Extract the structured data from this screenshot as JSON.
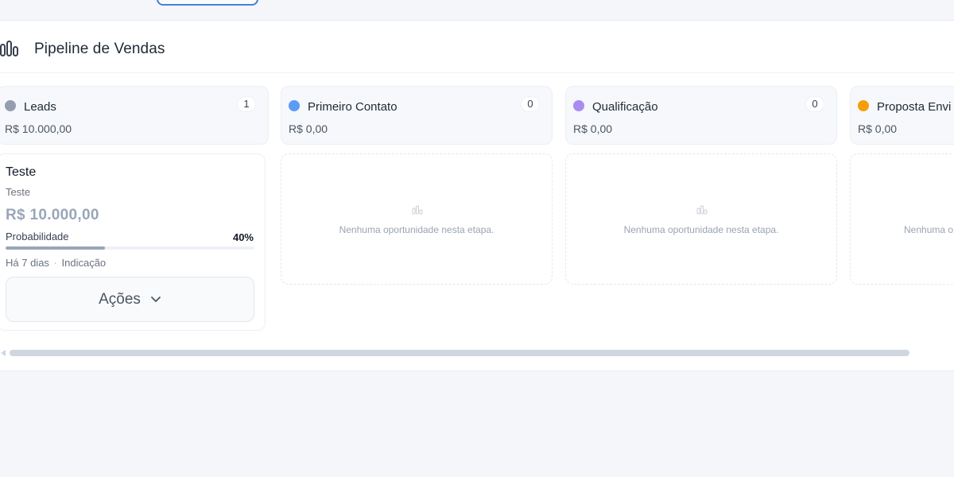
{
  "panel": {
    "title": "Pipeline de Vendas",
    "icon": "bar-chart-icon"
  },
  "stages": [
    {
      "name": "Leads",
      "count": "1",
      "total": "R$ 10.000,00",
      "color": "#949eae"
    },
    {
      "name": "Primeiro Contato",
      "count": "0",
      "total": "R$ 0,00",
      "color": "#5b9cf5"
    },
    {
      "name": "Qualificação",
      "count": "0",
      "total": "R$ 0,00",
      "color": "#a98cf2"
    },
    {
      "name": "Proposta Envi",
      "count": "",
      "total": "R$ 0,00",
      "color": "#f59e0b"
    }
  ],
  "card": {
    "title": "Teste",
    "subtitle": "Teste",
    "value": "R$ 10.000,00",
    "probability_label": "Probabilidade",
    "probability_value": "40%",
    "probability": 40,
    "meta_time": "Há 7 dias",
    "meta_separator": "·",
    "meta_source": "Indicação",
    "actions_label": "Ações",
    "actions_icon": "chevron-down-icon"
  },
  "empty": {
    "message": "Nenhuma oportunidade nesta etapa.",
    "message_partial": "Nenhuma o",
    "icon": "empty-chart-icon"
  },
  "colors": {
    "accent": "#4a7fd9",
    "muted_value": "#9aa6b8"
  }
}
